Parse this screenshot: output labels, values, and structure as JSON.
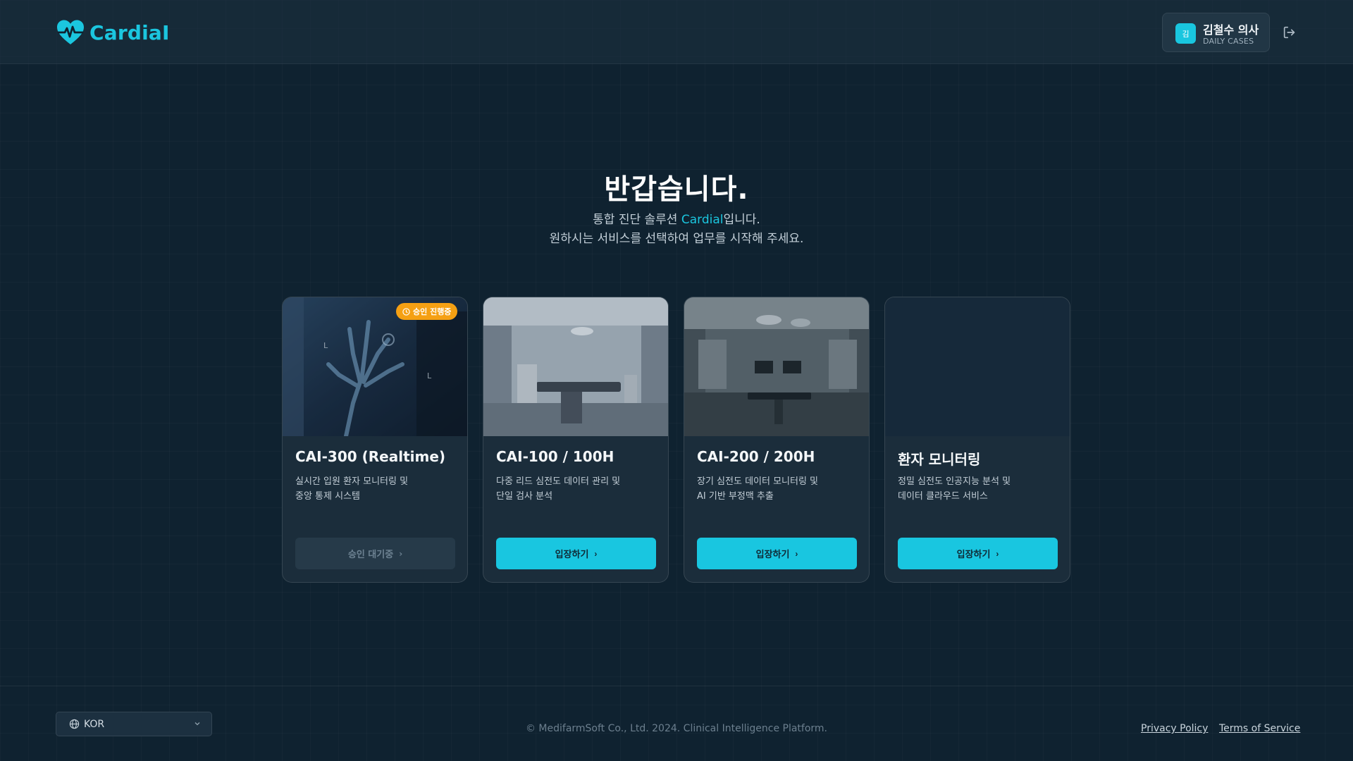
{
  "header": {
    "brand": "CardiaI",
    "user": {
      "avatar_initial": "김",
      "name": "김철수 의사",
      "role": "DAILY CASES"
    },
    "icons": {
      "logo": "heart-pulse-logo-icon",
      "logout": "logout-icon"
    }
  },
  "hero": {
    "title": "반갑습니다.",
    "line1_prefix": "통합 진단 솔루션 ",
    "line1_brand": "Cardial",
    "line1_suffix": "입니다.",
    "line2": "원하시는 서비스를 선택하여 업무를 시작해 주세요."
  },
  "cards": [
    {
      "title": "CAI-300 (Realtime)",
      "desc1": "실시간 입원 환자 모니터링 및",
      "desc2": "중앙 통제 시스템",
      "button": "승인 대기중",
      "badge": "승인 진행중",
      "status": "pending"
    },
    {
      "title": "CAI-100 / 100H",
      "desc1": "다중 리드 심전도 데이터 관리 및",
      "desc2": "단일 검사 분석",
      "button": "입장하기",
      "status": "active"
    },
    {
      "title": "CAI-200 / 200H",
      "desc1": "장기 심전도 데이터 모니터링 및",
      "desc2": "AI 기반 부정맥 추출",
      "button": "입장하기",
      "status": "active"
    },
    {
      "title": "환자 모니터링",
      "desc1": "정밀 심전도 인공지능 분석 및",
      "desc2": "데이터 클라우드 서비스",
      "button": "입장하기",
      "status": "active"
    }
  ],
  "footer": {
    "language": "KOR",
    "copyright": "© MedifarmSoft Co., Ltd. 2024. Clinical Intelligence Platform.",
    "privacy": "Privacy Policy",
    "terms": "Terms of Service"
  },
  "colors": {
    "accent": "#19c6e0",
    "background": "#0f2230",
    "badge": "#f5a013"
  }
}
